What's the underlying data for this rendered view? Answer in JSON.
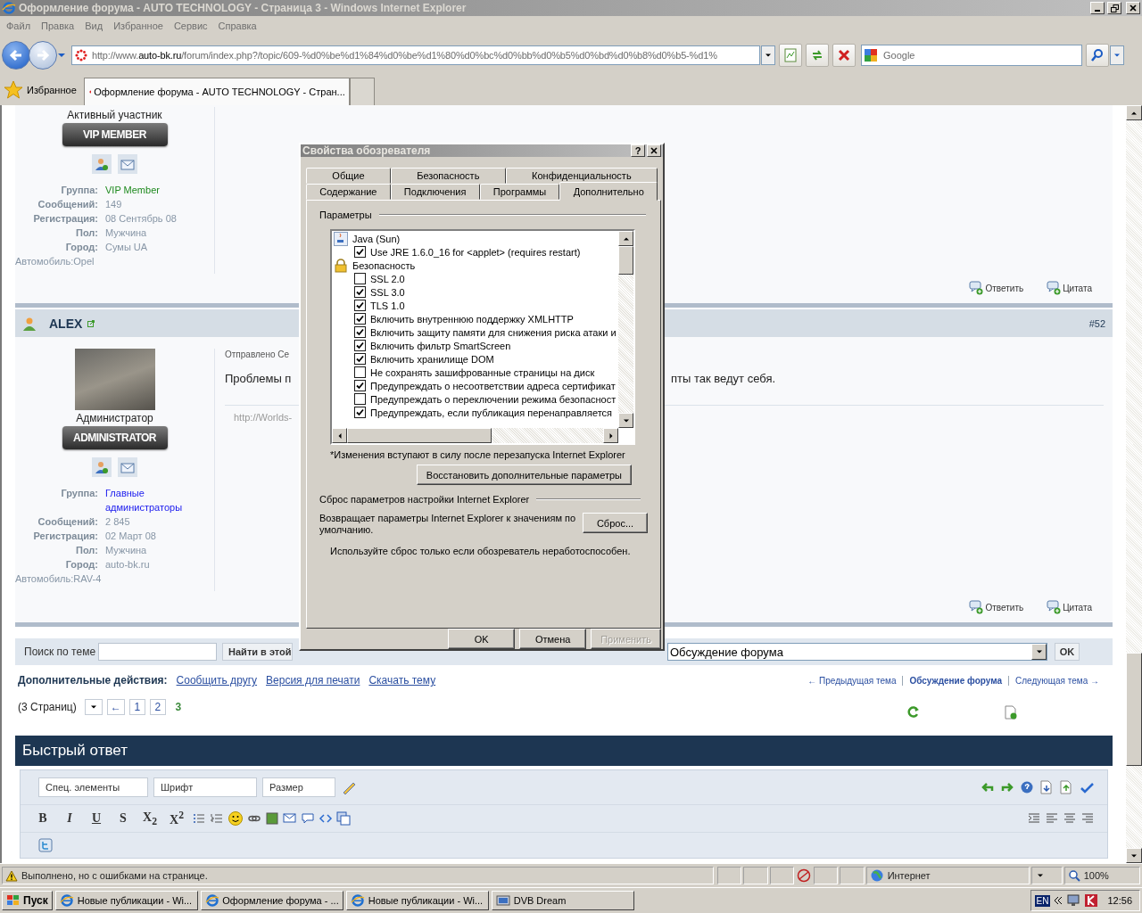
{
  "window": {
    "title": "Оформление форума - AUTO TECHNOLOGY - Страница 3 - Windows Internet Explorer"
  },
  "menu": [
    "Файл",
    "Правка",
    "Вид",
    "Избранное",
    "Сервис",
    "Справка"
  ],
  "address_bar": {
    "url_prefix": "http://www.",
    "url_domain": "auto-bk.ru",
    "url_path": "/forum/index.php?/topic/609-%d0%be%d1%84%d0%be%d1%80%d0%bc%d0%bb%d0%b5%d0%bd%d0%b8%d0%b5-%d1%"
  },
  "search_box": {
    "placeholder": "Google"
  },
  "favorites": {
    "label": "Избранное"
  },
  "tabs": [
    {
      "label": "Оформление форума - AUTO TECHNOLOGY - Стран...",
      "selected": true
    }
  ],
  "posts": [
    {
      "rank": "Активный участник",
      "badge": "VIP MEMBER",
      "details": [
        {
          "label": "Группа:",
          "value": "VIP Member",
          "color": "#1f8a1f"
        },
        {
          "label": "Сообщений:",
          "value": "149",
          "color": "#8796a6"
        },
        {
          "label": "Регистрация:",
          "value": "08 Сентябрь 08",
          "color": "#8796a6"
        },
        {
          "label": "Пол:",
          "value": "Мужчина",
          "color": "#8796a6"
        },
        {
          "label": "Город:",
          "value": "Сумы UA",
          "color": "#8796a6"
        }
      ],
      "car": "Автомобиль:Opel",
      "actions": [
        "Ответить",
        "Цитата"
      ]
    },
    {
      "author": "ALEX",
      "number": "#52",
      "rank": "Администратор",
      "badge": "ADMINISTRATOR",
      "details": [
        {
          "label": "Группа:",
          "value": "Главные администраторы",
          "color": "#1a1aee"
        },
        {
          "label": "Сообщений:",
          "value": "2  845",
          "color": "#8796a6"
        },
        {
          "label": "Регистрация:",
          "value": "02 Март 08",
          "color": "#8796a6"
        },
        {
          "label": "Пол:",
          "value": "Мужчина",
          "color": "#8796a6"
        },
        {
          "label": "Город:",
          "value": "auto-bk.ru",
          "color": "#8796a6"
        }
      ],
      "car": "Автомобиль:RAV-4",
      "sent": "Отправлено Се",
      "body": [
        "Проблемы п",
        "пты так ведут себя."
      ],
      "signature": "http://Worlds-",
      "actions": [
        "Ответить",
        "Цитата"
      ]
    }
  ],
  "topic_search": {
    "label": "Поиск по теме",
    "button": "Найти в этой",
    "forum": "Обсуждение форума",
    "ok": "OK"
  },
  "more_actions": {
    "label": "Дополнительные действия:",
    "links": [
      "Сообщить другу",
      "Версия для печати",
      "Скачать тему"
    ]
  },
  "topic_nav": [
    {
      "label": "← Предыдущая тема",
      "selected": false
    },
    {
      "label": "Обсуждение форума",
      "selected": true
    },
    {
      "label": "Следующая тема →",
      "selected": false
    }
  ],
  "pagination": {
    "label": "(3 Страниц)",
    "prev": "←",
    "pages": [
      {
        "label": "1",
        "selected": false
      },
      {
        "label": "2",
        "selected": false
      },
      {
        "label": "3",
        "selected": true
      }
    ]
  },
  "quick_reply": {
    "title": "Быстрый ответ",
    "selects": [
      "Спец. элементы",
      "Шрифт",
      "Размер"
    ],
    "format_buttons": [
      "B",
      "I",
      "U",
      "S",
      "X$_{2}$",
      "X$^{2}$"
    ]
  },
  "dialog": {
    "title": "Свойства обозревателя",
    "help": "?",
    "tab_rows": [
      [
        {
          "label": "Общие",
          "selected": false
        },
        {
          "label": "Безопасность",
          "selected": false
        },
        {
          "label": "Конфиденциальность",
          "selected": false
        }
      ],
      [
        {
          "label": "Содержание",
          "selected": false
        },
        {
          "label": "Подключения",
          "selected": false
        },
        {
          "label": "Программы",
          "selected": false
        },
        {
          "label": "Дополнительно",
          "selected": true
        }
      ]
    ],
    "settings_label": "Параметры",
    "options": [
      {
        "label": "Java (Sun)",
        "children": [
          {
            "label": "Use JRE 1.6.0_16 for <applet> (requires restart)",
            "checked": true
          }
        ]
      },
      {
        "label": "Безопасность",
        "children": [
          {
            "label": "SSL 2.0",
            "checked": false
          },
          {
            "label": "SSL 3.0",
            "checked": true
          },
          {
            "label": "TLS 1.0",
            "checked": true
          },
          {
            "label": "Включить внутреннюю поддержку XMLHTTP",
            "checked": true
          },
          {
            "label": "Включить защиту памяти для снижения риска атаки и",
            "checked": true
          },
          {
            "label": "Включить фильтр SmartScreen",
            "checked": true
          },
          {
            "label": "Включить хранилище DOM",
            "checked": true
          },
          {
            "label": "Не сохранять зашифрованные страницы на диск",
            "checked": false
          },
          {
            "label": "Предупреждать о несоответствии адреса сертификат",
            "checked": true
          },
          {
            "label": "Предупреждать о переключении режима безопасност",
            "checked": false
          },
          {
            "label": "Предупреждать, если публикация перенаправляется",
            "checked": true
          }
        ]
      }
    ],
    "note": "*Изменения вступают в силу после перезапуска Internet Explorer",
    "restore_button": "Восстановить дополнительные параметры",
    "reset_label": "Сброс параметров настройки Internet Explorer",
    "reset_text": "Возвращает параметры Internet Explorer к значениям по умолчанию.",
    "reset_button": "Сброс...",
    "reset_warning": "Используйте сброс только если обозреватель неработоспособен.",
    "buttons": [
      {
        "label": "OK",
        "disabled": false
      },
      {
        "label": "Отмена",
        "disabled": false
      },
      {
        "label": "Применить",
        "disabled": true
      }
    ]
  },
  "status_bar": {
    "text": "Выполнено, но с ошибками на странице.",
    "zone": "Интернет",
    "zoom": "100%"
  },
  "taskbar": {
    "start": "Пуск",
    "items": [
      "Новые публикации - Wi...",
      "Оформление форума - ...",
      "Новые публикации - Wi...",
      "DVB Dream"
    ],
    "lang": "EN",
    "time": "12:56"
  }
}
